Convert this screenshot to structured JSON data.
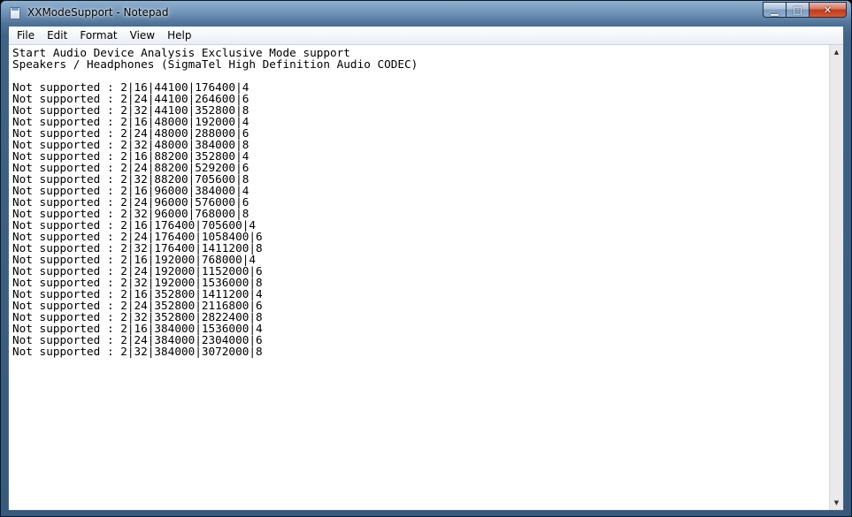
{
  "window": {
    "title": "XXModeSupport - Notepad",
    "icon": "notepad-icon"
  },
  "caption_buttons": {
    "minimize": "▁",
    "maximize": "□",
    "close": "✕"
  },
  "menu": [
    "File",
    "Edit",
    "Format",
    "View",
    "Help"
  ],
  "document": {
    "lines": [
      "Start Audio Device Analysis Exclusive Mode support",
      "Speakers / Headphones (SigmaTel High Definition Audio CODEC)",
      "",
      "Not supported : 2|16|44100|176400|4",
      "Not supported : 2|24|44100|264600|6",
      "Not supported : 2|32|44100|352800|8",
      "Not supported : 2|16|48000|192000|4",
      "Not supported : 2|24|48000|288000|6",
      "Not supported : 2|32|48000|384000|8",
      "Not supported : 2|16|88200|352800|4",
      "Not supported : 2|24|88200|529200|6",
      "Not supported : 2|32|88200|705600|8",
      "Not supported : 2|16|96000|384000|4",
      "Not supported : 2|24|96000|576000|6",
      "Not supported : 2|32|96000|768000|8",
      "Not supported : 2|16|176400|705600|4",
      "Not supported : 2|24|176400|1058400|6",
      "Not supported : 2|32|176400|1411200|8",
      "Not supported : 2|16|192000|768000|4",
      "Not supported : 2|24|192000|1152000|6",
      "Not supported : 2|32|192000|1536000|8",
      "Not supported : 2|16|352800|1411200|4",
      "Not supported : 2|24|352800|2116800|6",
      "Not supported : 2|32|352800|2822400|8",
      "Not supported : 2|16|384000|1536000|4",
      "Not supported : 2|24|384000|2304000|6",
      "Not supported : 2|32|384000|3072000|8"
    ]
  },
  "scrollbar": {
    "up_arrow": "▲",
    "down_arrow": "▼"
  }
}
